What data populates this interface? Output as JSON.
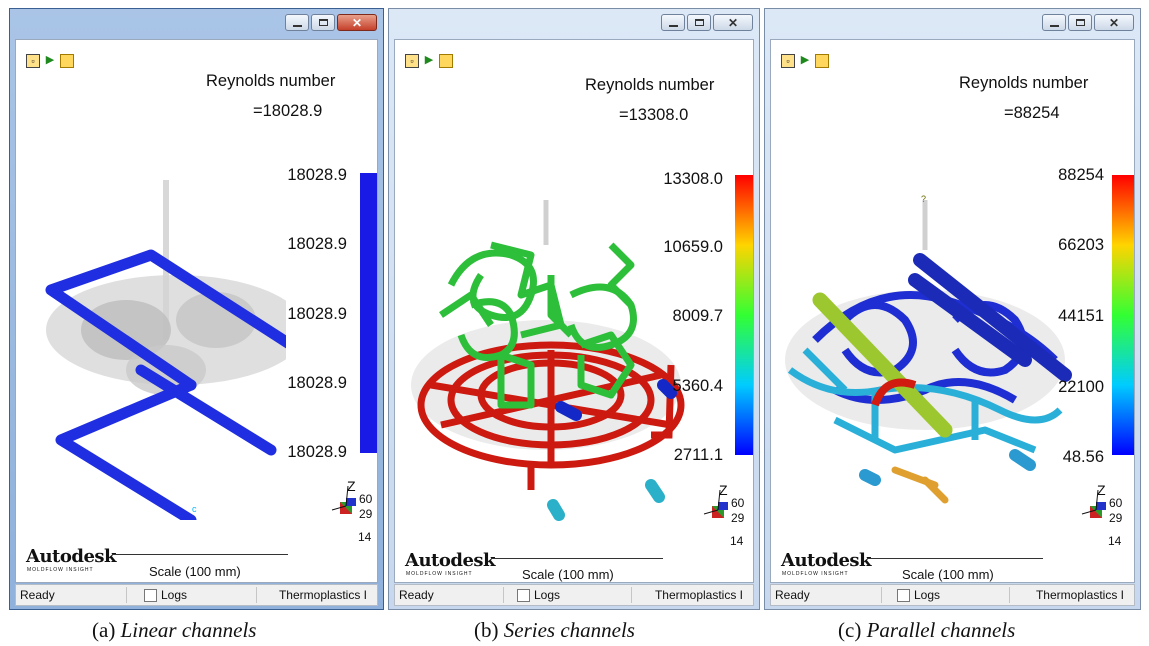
{
  "common": {
    "title": "Reynolds number",
    "logo": "Autodesk",
    "logo_sub": "MOLDFLOW INSIGHT",
    "scale_label": "Scale (100 mm)",
    "status_ready": "Ready",
    "status_logs": "Logs",
    "status_thermo": "Thermoplastics I",
    "axis_z": "Z",
    "axis_nums": [
      "60",
      "29",
      "14"
    ]
  },
  "panels": [
    {
      "value_text": "=18028.9",
      "ticks": [
        "18028.9",
        "18028.9",
        "18028.9",
        "18028.9",
        "18028.9"
      ],
      "legend_colors": [
        "#1a1ae6",
        "#1a1ae6"
      ],
      "caption_prefix": "(a) ",
      "caption_name": "Linear channels"
    },
    {
      "value_text": "=13308.0",
      "ticks": [
        "13308.0",
        "10659.0",
        "8009.7",
        "5360.4",
        "2711.1"
      ],
      "legend_colors": [
        "#ff0000",
        "#ffd400",
        "#33ff33",
        "#00ccff",
        "#0000ff"
      ],
      "caption_prefix": "(b) ",
      "caption_name": "Series channels"
    },
    {
      "value_text": "=88254",
      "ticks": [
        "88254",
        "66203",
        "44151",
        "22100",
        "48.56"
      ],
      "legend_colors": [
        "#ff0000",
        "#ffd400",
        "#33ff33",
        "#00ccff",
        "#0000ff"
      ],
      "caption_prefix": "(c) ",
      "caption_name": "Parallel channels"
    }
  ]
}
